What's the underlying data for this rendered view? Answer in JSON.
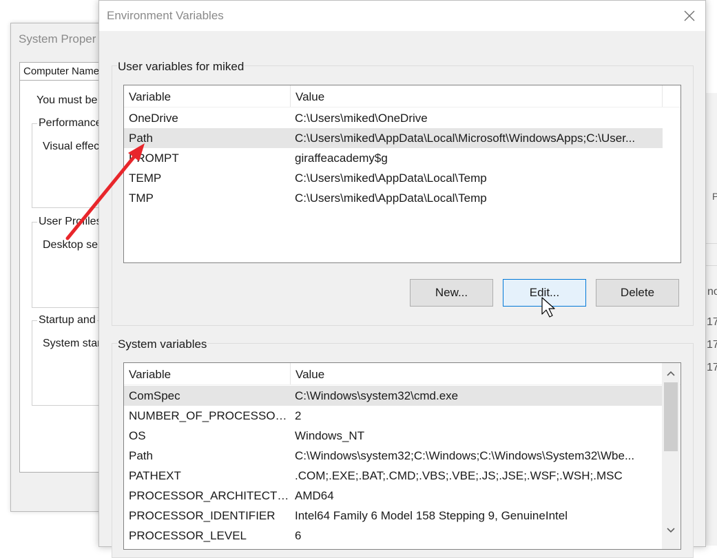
{
  "background_window": {
    "title": "System Proper",
    "tab_label": "Computer Name",
    "notice": "You must be",
    "performance": {
      "legend": "Performance",
      "text": "Visual effec"
    },
    "user_profiles": {
      "legend": "User Profiles",
      "text": "Desktop se"
    },
    "startup": {
      "legend": "Startup and",
      "text": "System star"
    }
  },
  "right_window": {
    "items": [
      "P",
      "no",
      "17",
      "17",
      "17"
    ]
  },
  "dialog": {
    "title": "Environment Variables",
    "close_icon": "close-icon"
  },
  "user_vars": {
    "group_label": "User variables for miked",
    "columns": {
      "variable": "Variable",
      "value": "Value"
    },
    "rows": [
      {
        "name": "OneDrive",
        "value": "C:\\Users\\miked\\OneDrive"
      },
      {
        "name": "Path",
        "value": "C:\\Users\\miked\\AppData\\Local\\Microsoft\\WindowsApps;C:\\User..."
      },
      {
        "name": "PROMPT",
        "value": "giraffeacademy$g"
      },
      {
        "name": "TEMP",
        "value": "C:\\Users\\miked\\AppData\\Local\\Temp"
      },
      {
        "name": "TMP",
        "value": "C:\\Users\\miked\\AppData\\Local\\Temp"
      }
    ],
    "selected_index": 1,
    "buttons": {
      "new": "New...",
      "edit": "Edit...",
      "delete": "Delete"
    }
  },
  "system_vars": {
    "group_label": "System variables",
    "columns": {
      "variable": "Variable",
      "value": "Value"
    },
    "rows": [
      {
        "name": "ComSpec",
        "value": "C:\\Windows\\system32\\cmd.exe"
      },
      {
        "name": "NUMBER_OF_PROCESSORS",
        "value": "2"
      },
      {
        "name": "OS",
        "value": "Windows_NT"
      },
      {
        "name": "Path",
        "value": "C:\\Windows\\system32;C:\\Windows;C:\\Windows\\System32\\Wbe..."
      },
      {
        "name": "PATHEXT",
        "value": ".COM;.EXE;.BAT;.CMD;.VBS;.VBE;.JS;.JSE;.WSF;.WSH;.MSC"
      },
      {
        "name": "PROCESSOR_ARCHITECTURE",
        "value": "AMD64"
      },
      {
        "name": "PROCESSOR_IDENTIFIER",
        "value": "Intel64 Family 6 Model 158 Stepping 9, GenuineIntel"
      },
      {
        "name": "PROCESSOR_LEVEL",
        "value": "6"
      }
    ],
    "selected_index": 0
  },
  "annotation": {
    "arrow_color": "#e8262b"
  },
  "colors": {
    "selection": "#e5e5e5",
    "button_hover_border": "#0078d7"
  }
}
